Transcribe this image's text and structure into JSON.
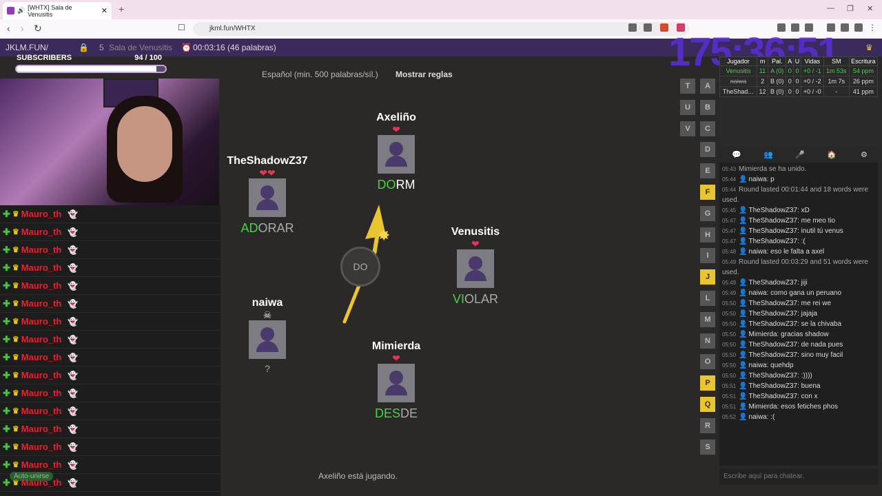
{
  "browser": {
    "tab_title": "[WHTX] Sala de Venusitis",
    "url": "jkml.fun/WHTX"
  },
  "gamebar": {
    "site": "JKLM.FUN/",
    "players": "5",
    "room": "Sala de Venusitis",
    "timer": "00:03:16 (46 palabras)"
  },
  "overlay": {
    "subs_label": "SUBSCRIBERS",
    "subs_count": "94  / 100",
    "subs_fill": 0.94,
    "clock": "175:36:51",
    "auto_join": "Auto-unirse"
  },
  "left_list": [
    "Mauro_th",
    "Mauro_th",
    "Mauro_th",
    "Mauro_th",
    "Mauro_th",
    "Mauro_th",
    "Mauro_th",
    "Mauro_th",
    "Mauro_th",
    "Mauro_th",
    "Mauro_th",
    "Mauro_th",
    "Mauro_th",
    "Mauro_th",
    "Mauro_th",
    "Mauro_th"
  ],
  "main": {
    "language": "Español (min. 500 palabras/síl.)",
    "rules": "Mostrar reglas",
    "syllable": "DO",
    "status": "Axeliño está jugando."
  },
  "players": [
    {
      "name": "Axeliño",
      "hearts": "❤",
      "word_hl": "DO",
      "word_rest": "RM"
    },
    {
      "name": "TheShadowZ37",
      "hearts": "❤❤",
      "word_hl": "AD",
      "word_rest": "ORAR"
    },
    {
      "name": "Venusitis",
      "hearts": "❤",
      "word_hl": "VI",
      "word_rest": "OLAR"
    },
    {
      "name": "naiwa",
      "hearts": "☠",
      "word_hl": "",
      "word_rest": "?"
    },
    {
      "name": "Mimierda",
      "hearts": "❤",
      "word_hl": "DES",
      "word_rest": "DE"
    }
  ],
  "letters": [
    "T",
    "U",
    "V",
    "A",
    "B",
    "C",
    "D",
    "E",
    "F",
    "G",
    "H",
    "I",
    "J",
    "L",
    "M",
    "N",
    "O",
    "P",
    "Q",
    "R",
    "S"
  ],
  "scoreboard": {
    "headers": [
      "Jugador",
      "m",
      "Pal.",
      "A",
      "U",
      "Vidas",
      "SM",
      "Escritura"
    ],
    "rows": [
      [
        "Venusitis",
        "11",
        "A (0)",
        "0",
        "0",
        "+0 / -1",
        "1m 53s",
        "54 ppm"
      ],
      [
        "naiwa",
        "2",
        "B (0)",
        "0",
        "0",
        "+0 / -2",
        "1m 7s",
        "26 ppm"
      ],
      [
        "TheShad…",
        "12",
        "B (0)",
        "0",
        "0",
        "+0 / -0",
        "-",
        "41 ppm"
      ]
    ]
  },
  "chat": [
    {
      "t": "05:43",
      "text": "Mimierda se ha unido.",
      "sys": true
    },
    {
      "t": "05:44",
      "u": "naiwa",
      "text": "p"
    },
    {
      "t": "05:44",
      "text": "Round lasted 00:01:44 and 18 words were used.",
      "sys": true
    },
    {
      "t": "05:45",
      "u": "TheShadowZ37",
      "text": "xD"
    },
    {
      "t": "05:47",
      "u": "TheShadowZ37",
      "text": "me meo tio"
    },
    {
      "t": "05:47",
      "u": "TheShadowZ37",
      "text": "inutil tú venus"
    },
    {
      "t": "05:47",
      "u": "TheShadowZ37",
      "text": ":("
    },
    {
      "t": "05:48",
      "u": "naiwa",
      "text": "eso le falta a axel"
    },
    {
      "t": "05:49",
      "text": "Round lasted 00:03:29 and 51 words were used.",
      "sys": true
    },
    {
      "t": "05:49",
      "u": "TheShadowZ37",
      "text": "jiji"
    },
    {
      "t": "05:49",
      "u": "naiwa",
      "text": "como gana un peruano"
    },
    {
      "t": "05:50",
      "u": "TheShadowZ37",
      "text": "me rei we"
    },
    {
      "t": "05:50",
      "u": "TheShadowZ37",
      "text": "jajaja"
    },
    {
      "t": "05:50",
      "u": "TheShadowZ37",
      "text": "se la chivaba"
    },
    {
      "t": "05:50",
      "u": "Mimierda",
      "text": "gracias shadow"
    },
    {
      "t": "05:50",
      "u": "TheShadowZ37",
      "text": "de nada pues"
    },
    {
      "t": "05:50",
      "u": "TheShadowZ37",
      "text": "sino muy facil"
    },
    {
      "t": "05:50",
      "u": "naiwa",
      "text": "quehdp"
    },
    {
      "t": "05:50",
      "u": "TheShadowZ37",
      "text": ":))))"
    },
    {
      "t": "05:51",
      "u": "TheShadowZ37",
      "text": "buena"
    },
    {
      "t": "05:51",
      "u": "TheShadowZ37",
      "text": "con x"
    },
    {
      "t": "05:51",
      "u": "Mimierda",
      "text": "esos fetiches phos"
    },
    {
      "t": "05:52",
      "u": "naiwa",
      "text": ":("
    }
  ],
  "chat_placeholder": "Escribe aquí para chatear."
}
